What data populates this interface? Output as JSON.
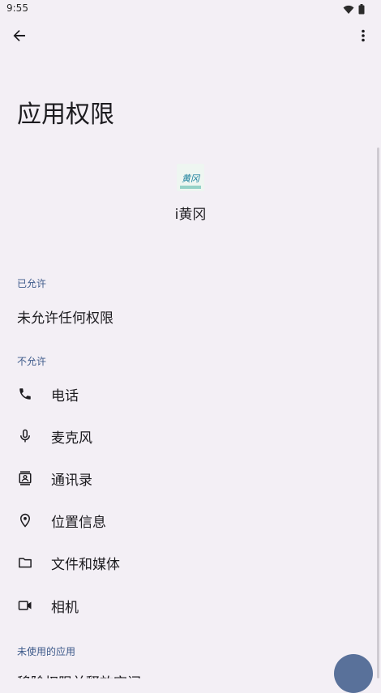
{
  "status": {
    "time": "9:55"
  },
  "page": {
    "title": "应用权限"
  },
  "app": {
    "name": "i黄冈",
    "icon_text": "黄冈"
  },
  "sections": {
    "allowed": {
      "label": "已允许",
      "empty_text": "未允许任何权限"
    },
    "denied": {
      "label": "不允许",
      "items": [
        {
          "label": "电话",
          "icon": "phone-icon"
        },
        {
          "label": "麦克风",
          "icon": "microphone-icon"
        },
        {
          "label": "通讯录",
          "icon": "contacts-icon"
        },
        {
          "label": "位置信息",
          "icon": "location-icon"
        },
        {
          "label": "文件和媒体",
          "icon": "folder-icon"
        },
        {
          "label": "相机",
          "icon": "camera-icon"
        }
      ]
    },
    "unused": {
      "label": "未使用的应用",
      "next_row_text": "移除权限并释放空间"
    }
  },
  "colors": {
    "background": "#f3eff5",
    "section_label": "#3d5a8a",
    "text": "#1c1b1f"
  }
}
